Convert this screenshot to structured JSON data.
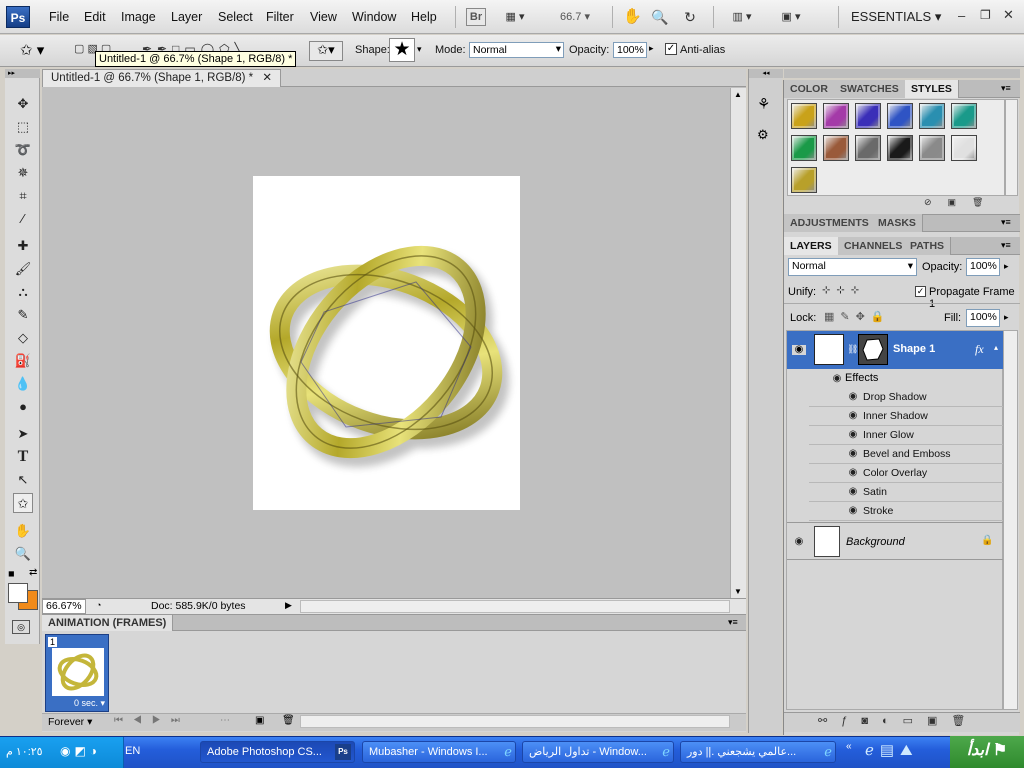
{
  "app": {
    "logo": "Ps"
  },
  "menu": [
    "File",
    "Edit",
    "Image",
    "Layer",
    "Select",
    "Filter",
    "View",
    "Window",
    "Help"
  ],
  "toolbar_top": {
    "br": "Br",
    "zoom": "66.7",
    "workspace": "ESSENTIALS"
  },
  "options": {
    "shape_label": "Shape:",
    "mode_label": "Mode:",
    "mode_value": "Normal",
    "opacity_label": "Opacity:",
    "opacity_value": "100%",
    "antialias_label": "Anti-alias"
  },
  "tooltip": "Untitled-1 @ 66.7% (Shape 1, RGB/8) *",
  "document": {
    "tab_title": "Untitled-1 @ 66.7% (Shape 1, RGB/8) *",
    "zoom_status": "66.67%",
    "doc_info": "Doc: 585.9K/0 bytes"
  },
  "animation": {
    "title": "ANIMATION (FRAMES)",
    "frame_number": "1",
    "frame_delay": "0 sec.",
    "loop": "Forever"
  },
  "styles_panel": {
    "tabs": [
      "COLOR",
      "SWATCHES",
      "STYLES"
    ],
    "active_tab": "STYLES",
    "swatches": [
      "#c9a21a",
      "#a43aa8",
      "#3a2fb8",
      "#2f54c4",
      "#2a8fb0",
      "#1a9a8a",
      "#1a9a48",
      "#9a5a3a",
      "#6a6a6a",
      "#1a1a1a",
      "#8a8a8a",
      "#e0e0e0",
      "#b8a02a"
    ]
  },
  "adjust_panel": {
    "tabs": [
      "ADJUSTMENTS",
      "MASKS"
    ]
  },
  "layers_panel": {
    "tabs": [
      "LAYERS",
      "CHANNELS",
      "PATHS"
    ],
    "blend_mode": "Normal",
    "opacity_label": "Opacity:",
    "opacity_value": "100%",
    "unify_label": "Unify:",
    "propagate_label": "Propagate Frame 1",
    "lock_label": "Lock:",
    "fill_label": "Fill:",
    "fill_value": "100%",
    "shape_layer": "Shape 1",
    "effects_label": "Effects",
    "effects": [
      "Drop Shadow",
      "Inner Shadow",
      "Inner Glow",
      "Bevel and Emboss",
      "Color Overlay",
      "Satin",
      "Stroke"
    ],
    "background_layer": "Background"
  },
  "taskbar": {
    "start": "ابدأ",
    "clock": "١٠:٢٥ م",
    "lang": "EN",
    "tasks": [
      "Adobe Photoshop CS...",
      "Mubasher - Windows I...",
      "تداول الرياض - Window...",
      "عالمي يشجعني .|| دور..."
    ]
  }
}
